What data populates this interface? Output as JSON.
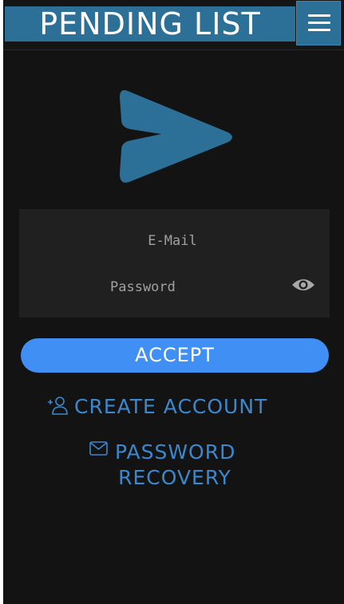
{
  "header": {
    "title": "PENDING LIST",
    "menu_icon": "hamburger-menu-icon"
  },
  "logo": {
    "icon": "play-arrow-logo",
    "color": "#2c6f97"
  },
  "form": {
    "email_placeholder": "E-Mail",
    "password_placeholder": "Password",
    "show_password_icon": "eye-icon"
  },
  "actions": {
    "accept_label": "ACCEPT",
    "create_account_label": "CREATE ACCOUNT",
    "create_account_icon": "user-plus-icon",
    "password_recovery_line1": "PASSWORD",
    "password_recovery_line2": "RECOVERY",
    "password_recovery_icon": "mail-icon"
  },
  "colors": {
    "background": "#131313",
    "header_accent": "#2c6f97",
    "button_accent": "#3f8ff5",
    "link_color": "#3b88cf",
    "input_panel": "#202020"
  }
}
